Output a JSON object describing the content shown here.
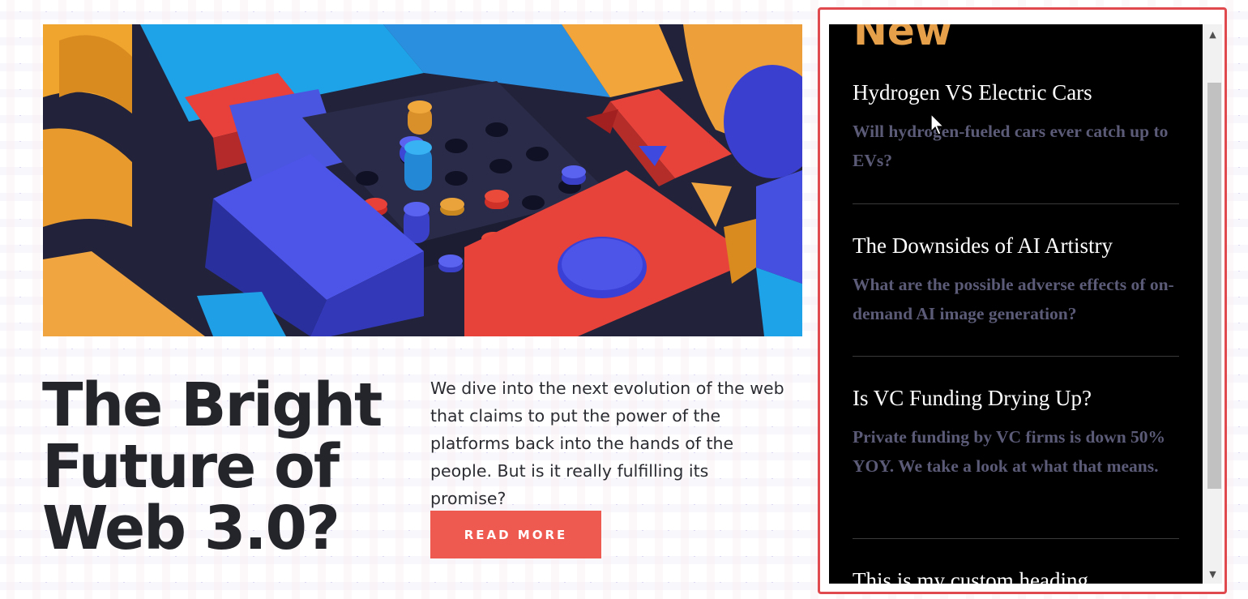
{
  "article": {
    "headline": "The Bright Future of Web 3.0?",
    "blurb": "We dive into the next evolution of the web that claims to put the power of the platforms back into the hands of the people. But is it really fulfilling its promise?",
    "cta_label": "READ MORE",
    "hero_image": "colorful-3d-geometric-blocks-image"
  },
  "sidebar": {
    "title": "New",
    "posts": [
      {
        "title": "Hydrogen VS Electric Cars",
        "description": "Will hydrogen-fueled cars ever catch up to EVs?"
      },
      {
        "title": "The Downsides of AI Artistry",
        "description": "What are the possible adverse effects of on-demand AI image generation?"
      },
      {
        "title": "Is VC Funding Drying Up?",
        "description": "Private funding by VC firms is down 50% YOY. We take a look at what that means."
      },
      {
        "title": "This is my custom heading",
        "description": ""
      }
    ]
  },
  "scrollbar": {
    "up_icon": "arrow-up-icon",
    "down_icon": "arrow-down-icon"
  },
  "colors": {
    "accent_red": "#ee5a4f",
    "panel_outline": "#e04a4e",
    "panel_title": "#e7a04a",
    "post_desc": "#5b5b78"
  }
}
